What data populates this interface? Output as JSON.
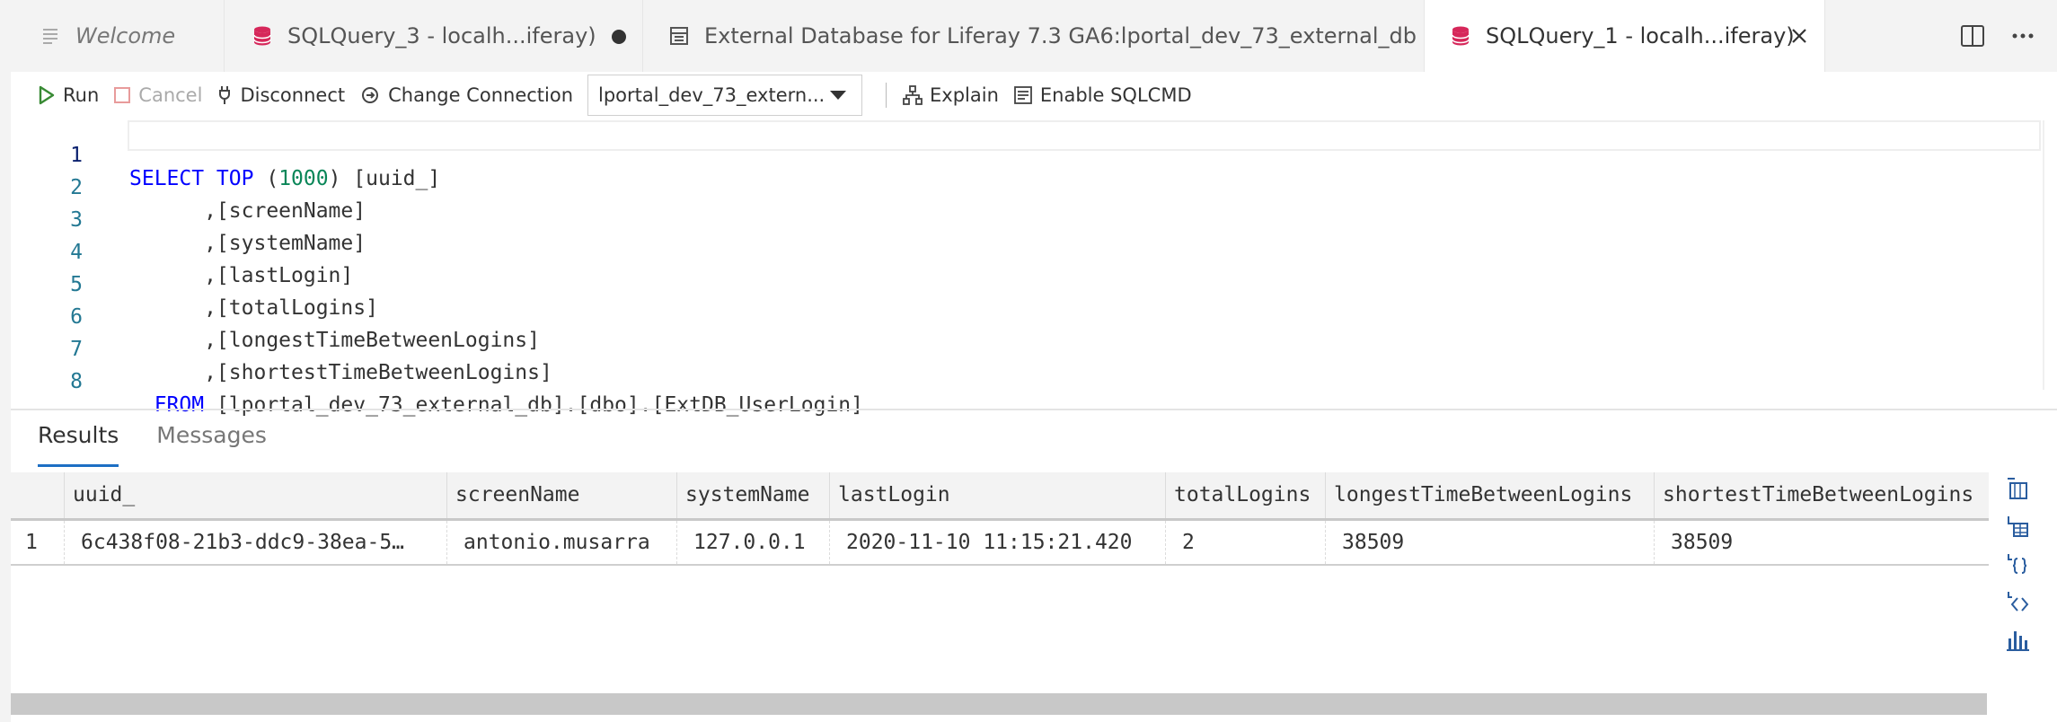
{
  "tabs": [
    {
      "label": "Welcome",
      "icon": "document-lines-icon"
    },
    {
      "label": "SQLQuery_3 - localh...iferay)",
      "icon": "database-icon",
      "dirty": true
    },
    {
      "label": "External Database for Liferay 7.3 GA6:lportal_dev_73_external_db",
      "icon": "table-icon"
    },
    {
      "label": "SQLQuery_1 - localh...iferay)",
      "icon": "database-icon",
      "active": true
    }
  ],
  "toolbar": {
    "run": "Run",
    "cancel": "Cancel",
    "disconnect": "Disconnect",
    "change_connection": "Change Connection",
    "database": "lportal_dev_73_extern...",
    "explain": "Explain",
    "sqlcmd": "Enable SQLCMD"
  },
  "editor": {
    "line_numbers": [
      "1",
      "2",
      "3",
      "4",
      "5",
      "6",
      "7",
      "8"
    ],
    "line1": {
      "kw": "SELECT TOP",
      "open": " (",
      "num": "1000",
      "rest": ") [uuid_]"
    },
    "lines": [
      "      ,[screenName]",
      "      ,[systemName]",
      "      ,[lastLogin]",
      "      ,[totalLogins]",
      "      ,[longestTimeBetweenLogins]",
      "      ,[shortestTimeBetweenLogins]"
    ],
    "line8": {
      "indent": "  ",
      "kw": "FROM",
      "rest": " [lportal_dev_73_external_db].[dbo].[ExtDB_UserLogin]"
    }
  },
  "results": {
    "tabs": [
      "Results",
      "Messages"
    ],
    "columns": [
      "uuid_",
      "screenName",
      "systemName",
      "lastLogin",
      "totalLogins",
      "longestTimeBetweenLogins",
      "shortestTimeBetweenLogins"
    ],
    "rows": [
      {
        "num": "1",
        "cells": [
          "6c438f08-21b3-ddc9-38ea-5…",
          "antonio.musarra",
          "127.0.0.1",
          "2020-11-10 11:15:21.420",
          "2",
          "38509",
          "38509"
        ]
      }
    ]
  },
  "colors": {
    "accent": "#1d6fc4",
    "db_icon": "#d6275a",
    "run": "#388a34",
    "keyword": "#0000ff",
    "number": "#098658",
    "line_number": "#237893"
  }
}
